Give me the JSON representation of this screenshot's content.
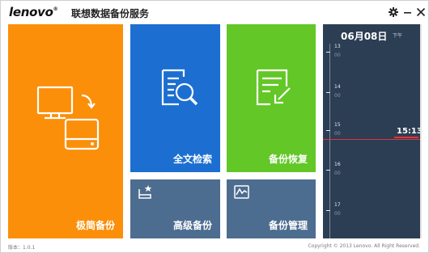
{
  "app": {
    "logo": "lenovo",
    "logo_mark": "®",
    "title": "联想数据备份服务"
  },
  "tiles": {
    "simple_backup": {
      "label": "极简备份",
      "color": "#fb8f0a"
    },
    "full_text_search": {
      "label": "全文检索",
      "color": "#1c6fd1"
    },
    "backup_restore": {
      "label": "备份恢复",
      "color": "#62c727"
    },
    "advanced_backup": {
      "label": "高级备份",
      "color": "#4d6d90"
    },
    "backup_manage": {
      "label": "备份管理",
      "color": "#4d6d90"
    }
  },
  "timeline": {
    "date": "06月08日",
    "ampm": "下午",
    "hours": [
      {
        "hour": "13",
        "min": "00"
      },
      {
        "hour": "14",
        "min": "00"
      },
      {
        "hour": "15",
        "min": "00"
      },
      {
        "hour": "16",
        "min": "00"
      },
      {
        "hour": "17",
        "min": "00"
      }
    ],
    "current_time": "15:13"
  },
  "footer": {
    "version": "版本：1.0.1",
    "copyright": "Copyright © 2013 Lenovo. All Right Reserved."
  }
}
